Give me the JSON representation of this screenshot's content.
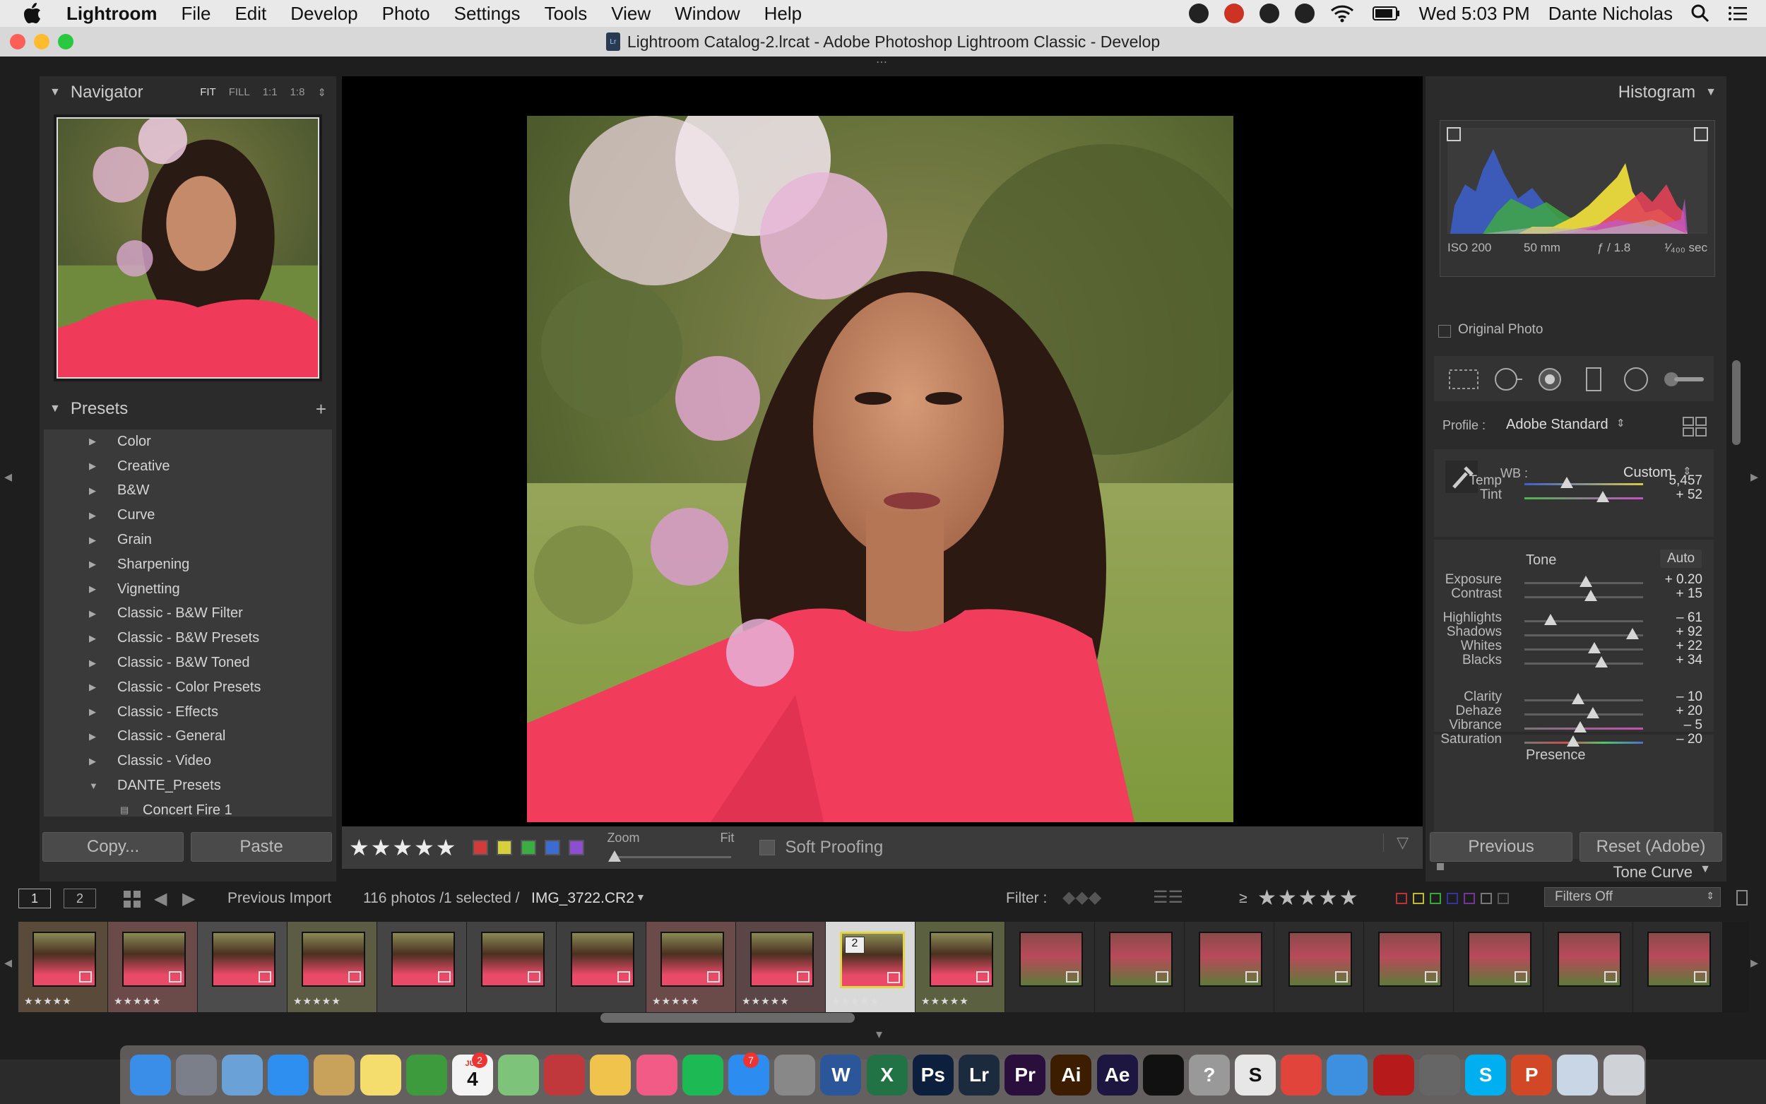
{
  "menubar": {
    "app_name": "Lightroom",
    "items": [
      "File",
      "Edit",
      "Develop",
      "Photo",
      "Settings",
      "Tools",
      "View",
      "Window",
      "Help"
    ],
    "clock": "Wed 5:03 PM",
    "user": "Dante Nicholas"
  },
  "window": {
    "title": "Lightroom Catalog-2.lrcat - Adobe Photoshop Lightroom Classic - Develop",
    "doc_badge": "Lr"
  },
  "navigator": {
    "title": "Navigator",
    "options": [
      "FIT",
      "FILL",
      "1:1",
      "1:8"
    ],
    "selected": "FIT"
  },
  "presets": {
    "title": "Presets",
    "add": "+",
    "items": [
      {
        "label": "Color"
      },
      {
        "label": "Creative"
      },
      {
        "label": "B&W"
      },
      {
        "label": "Curve"
      },
      {
        "label": "Grain"
      },
      {
        "label": "Sharpening"
      },
      {
        "label": "Vignetting"
      },
      {
        "label": "Classic - B&W Filter"
      },
      {
        "label": "Classic - B&W Presets"
      },
      {
        "label": "Classic - B&W Toned"
      },
      {
        "label": "Classic - Color Presets"
      },
      {
        "label": "Classic - Effects"
      },
      {
        "label": "Classic - General"
      },
      {
        "label": "Classic - Video"
      },
      {
        "label": "DANTE_Presets",
        "expanded": true
      }
    ],
    "sub_item": "Concert Fire 1"
  },
  "left_buttons": {
    "copy": "Copy...",
    "paste": "Paste"
  },
  "toolbar": {
    "rating": 5,
    "zoom_label": "Zoom",
    "zoom_value": "Fit",
    "soft_proofing": "Soft Proofing",
    "label_colors": [
      "#d23b3b",
      "#d6d03a",
      "#3aae45",
      "#3c6bd3",
      "#8d4fd1"
    ]
  },
  "histogram": {
    "title": "Histogram",
    "iso": "ISO 200",
    "focal": "50 mm",
    "aperture": "ƒ / 1.8",
    "shutter": "¹⁄₄₀₀ sec",
    "original_photo": "Original Photo"
  },
  "basic": {
    "profile_label": "Profile :",
    "profile_value": "Adobe Standard",
    "wb_label": "WB :",
    "wb_value": "Custom",
    "tone_title": "Tone",
    "auto": "Auto",
    "presence_title": "Presence",
    "next_panel": "Tone Curve",
    "sliders": [
      {
        "label": "Temp",
        "value": "5,457",
        "pos": 0.36,
        "group": "wb"
      },
      {
        "label": "Tint",
        "value": "+ 52",
        "pos": 0.66,
        "group": "wb"
      },
      {
        "label": "Exposure",
        "value": "+ 0.20",
        "pos": 0.52,
        "group": "tone"
      },
      {
        "label": "Contrast",
        "value": "+ 15",
        "pos": 0.56,
        "group": "tone"
      },
      {
        "label": "Highlights",
        "value": "– 61",
        "pos": 0.22,
        "group": "tone"
      },
      {
        "label": "Shadows",
        "value": "+ 92",
        "pos": 0.91,
        "group": "tone"
      },
      {
        "label": "Whites",
        "value": "+ 22",
        "pos": 0.59,
        "group": "tone"
      },
      {
        "label": "Blacks",
        "value": "+ 34",
        "pos": 0.65,
        "group": "tone"
      },
      {
        "label": "Clarity",
        "value": "– 10",
        "pos": 0.45,
        "group": "presence"
      },
      {
        "label": "Dehaze",
        "value": "+ 20",
        "pos": 0.58,
        "group": "presence"
      },
      {
        "label": "Vibrance",
        "value": "– 5",
        "pos": 0.47,
        "group": "presence"
      },
      {
        "label": "Saturation",
        "value": "– 20",
        "pos": 0.41,
        "group": "presence"
      }
    ]
  },
  "right_buttons": {
    "previous": "Previous",
    "reset": "Reset (Adobe)"
  },
  "filmstrip": {
    "page1": "1",
    "page2": "2",
    "source": "Previous Import",
    "count": "116 photos /1 selected /",
    "filename": "IMG_3722.CR2",
    "filter_label": "Filter :",
    "rating_op": "≥",
    "filter_value": "Filters Off",
    "selected_badge": "2",
    "selected_index": 9,
    "thumbs": [
      {
        "rated": true
      },
      {
        "rated": true
      },
      {
        "rated": false
      },
      {
        "rated": true
      },
      {
        "rated": false
      },
      {
        "rated": false
      },
      {
        "rated": false
      },
      {
        "rated": true
      },
      {
        "rated": true
      },
      {
        "rated": true
      },
      {
        "rated": true
      },
      {
        "rated": false
      },
      {
        "rated": false
      },
      {
        "rated": false
      },
      {
        "rated": false
      },
      {
        "rated": false
      },
      {
        "rated": false
      },
      {
        "rated": false
      },
      {
        "rated": false
      }
    ]
  },
  "dock": {
    "apps": [
      {
        "name": "finder-icon",
        "label": "",
        "color": "#3b8ee8"
      },
      {
        "name": "launchpad-icon",
        "label": "",
        "color": "#7a7f89"
      },
      {
        "name": "preview-icon",
        "label": "",
        "color": "#6aa1d6"
      },
      {
        "name": "safari-icon",
        "label": "",
        "color": "#2f8ff0"
      },
      {
        "name": "notes-icon",
        "label": "",
        "color": "#c8a15a"
      },
      {
        "name": "stickies-icon",
        "label": "",
        "color": "#f5dd6d"
      },
      {
        "name": "evernote-icon",
        "label": "",
        "color": "#3d9b3d"
      },
      {
        "name": "calendar-icon",
        "label": "4",
        "color": "#f4f4f4"
      },
      {
        "name": "maps-icon",
        "label": "",
        "color": "#7dc47a"
      },
      {
        "name": "photobooth-icon",
        "label": "",
        "color": "#c0383b"
      },
      {
        "name": "photos-icon",
        "label": "",
        "color": "#f0c34c"
      },
      {
        "name": "itunes-icon",
        "label": "",
        "color": "#f25b85"
      },
      {
        "name": "spotify-icon",
        "label": "",
        "color": "#1db954"
      },
      {
        "name": "appstore-icon",
        "label": "",
        "color": "#2d8cf0"
      },
      {
        "name": "system-preferences-icon",
        "label": "",
        "color": "#888"
      },
      {
        "name": "word-icon",
        "label": "W",
        "color": "#2b579a"
      },
      {
        "name": "excel-icon",
        "label": "X",
        "color": "#217346"
      },
      {
        "name": "photoshop-icon",
        "label": "Ps",
        "color": "#0c1f3c"
      },
      {
        "name": "lightroom-icon",
        "label": "Lr",
        "color": "#1b2b3d"
      },
      {
        "name": "premiere-icon",
        "label": "Pr",
        "color": "#2a0e3c"
      },
      {
        "name": "illustrator-icon",
        "label": "Ai",
        "color": "#3c1d00"
      },
      {
        "name": "aftereffects-icon",
        "label": "Ae",
        "color": "#1d1640"
      },
      {
        "name": "tidal-icon",
        "label": "",
        "color": "#111"
      },
      {
        "name": "help-icon",
        "label": "?",
        "color": "#999"
      },
      {
        "name": "sheets-icon",
        "label": "S",
        "color": "#e7e7e7"
      },
      {
        "name": "chrome-icon",
        "label": "",
        "color": "#e0443b"
      },
      {
        "name": "keynote-icon",
        "label": "",
        "color": "#3d8fe0"
      },
      {
        "name": "acrobat-icon",
        "label": "",
        "color": "#b71a1a"
      },
      {
        "name": "screenshot-icon",
        "label": "",
        "color": "#666"
      },
      {
        "name": "skype-icon",
        "label": "S",
        "color": "#00aff0"
      },
      {
        "name": "powerpoint-icon",
        "label": "P",
        "color": "#d24726"
      },
      {
        "name": "mail-icon",
        "label": "",
        "color": "#c9d6e6"
      },
      {
        "name": "trash-icon",
        "label": "",
        "color": "#cfd3d8"
      }
    ]
  },
  "badges": {
    "calendar_badge": "2",
    "appstore_badge": "7",
    "calendar_month": "JUL"
  }
}
